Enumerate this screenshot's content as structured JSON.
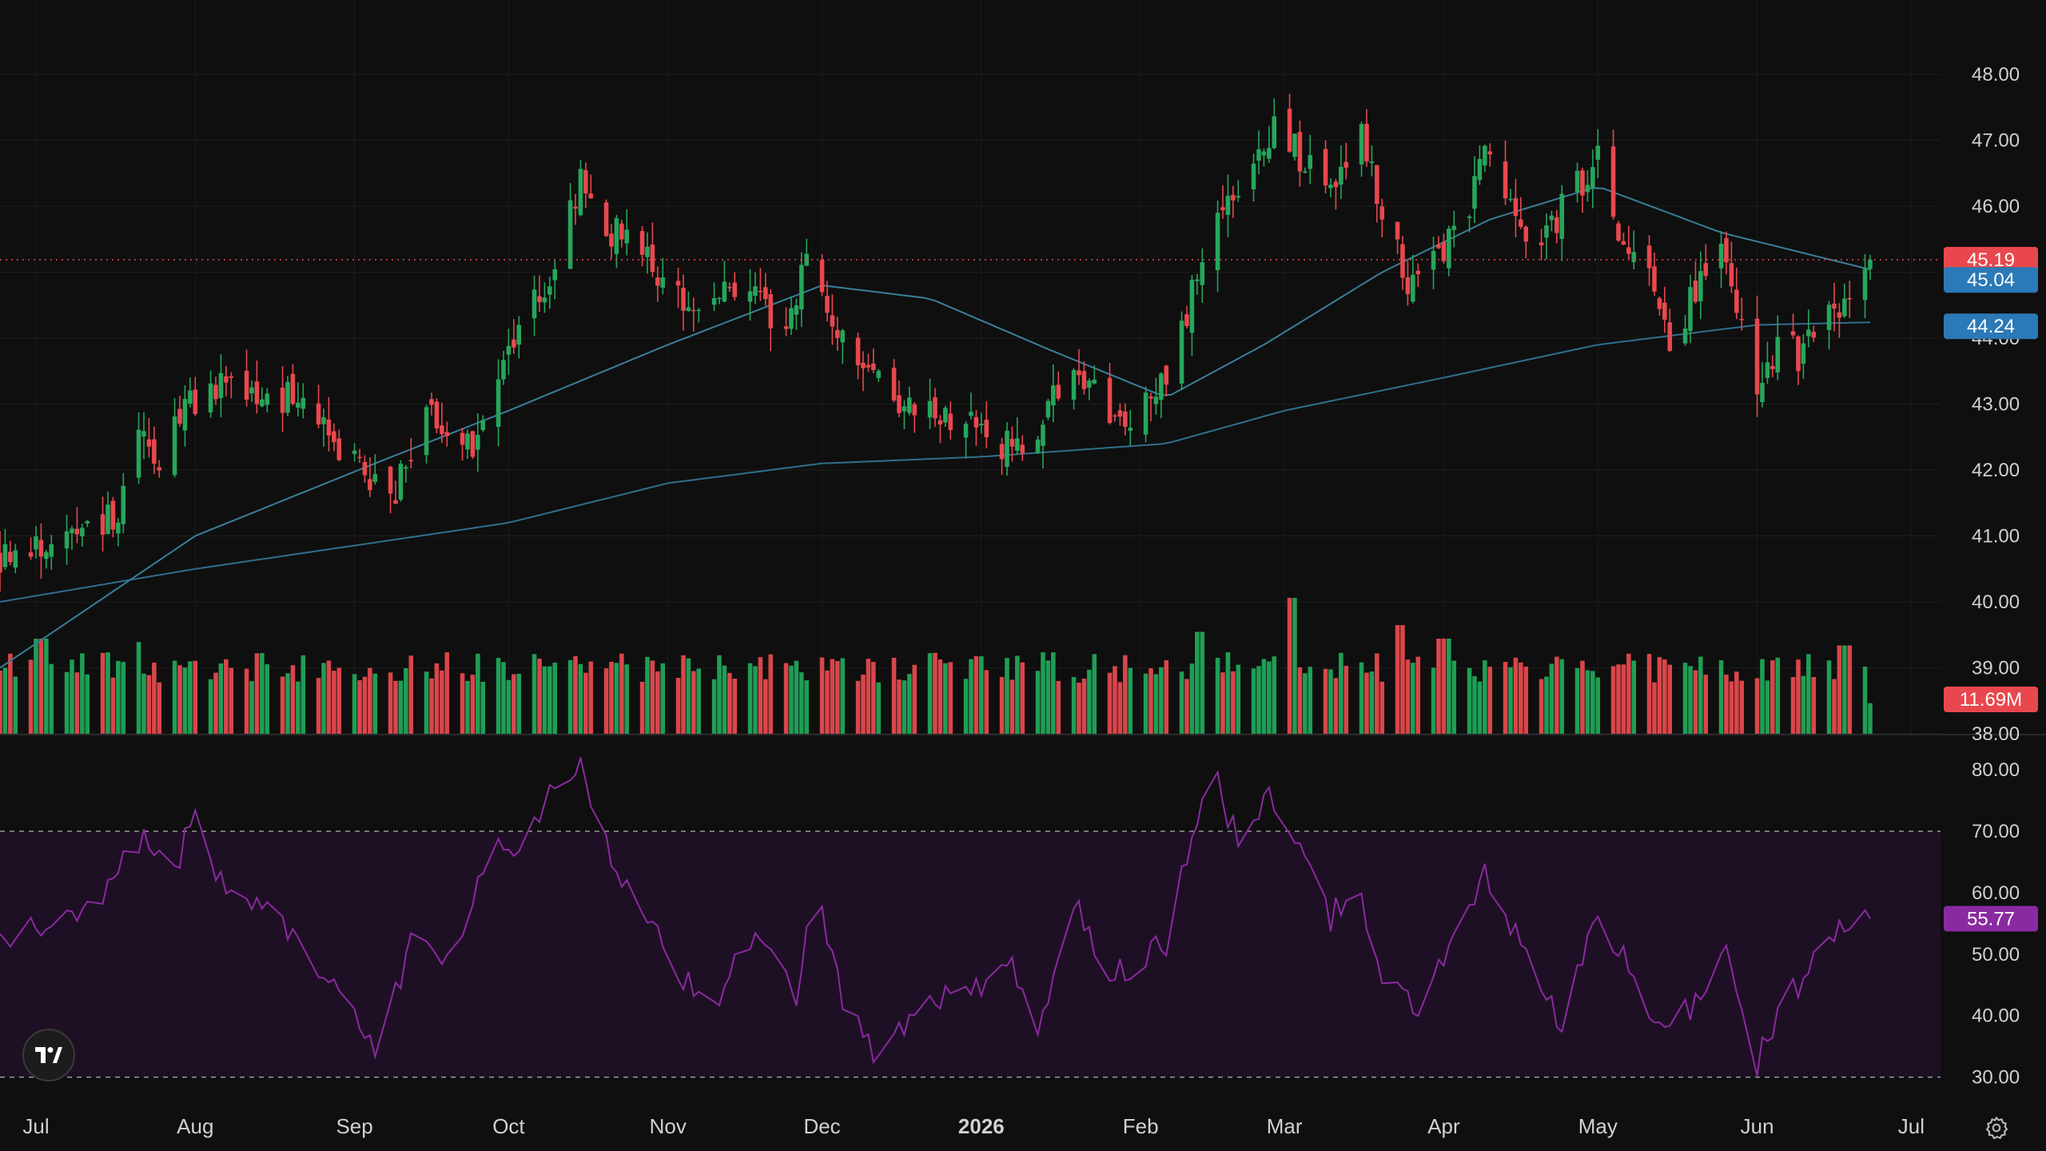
{
  "chart_data": {
    "type": "candlestick",
    "x_range": [
      "2025-06-24",
      "2026-06-23"
    ],
    "x_tick_labels": [
      {
        "label": "Jul",
        "date": "2025-07-01"
      },
      {
        "label": "Aug",
        "date": "2025-08-01"
      },
      {
        "label": "Sep",
        "date": "2025-09-01"
      },
      {
        "label": "Oct",
        "date": "2025-10-01"
      },
      {
        "label": "Nov",
        "date": "2025-11-01"
      },
      {
        "label": "Dec",
        "date": "2025-12-01"
      },
      {
        "label": "2026",
        "date": "2026-01-01"
      },
      {
        "label": "Feb",
        "date": "2026-02-01"
      },
      {
        "label": "Mar",
        "date": "2026-03-01"
      },
      {
        "label": "Apr",
        "date": "2026-04-01"
      },
      {
        "label": "May",
        "date": "2026-05-01"
      },
      {
        "label": "Jun",
        "date": "2026-06-01"
      },
      {
        "label": "Jul",
        "date": "2026-07-01"
      }
    ],
    "price_axis": {
      "ylim": [
        38.0,
        48.4
      ],
      "ticks": [
        "48.00",
        "47.00",
        "46.00",
        "45.00",
        "44.00",
        "43.00",
        "42.00",
        "41.00",
        "40.00",
        "39.00",
        "38.00"
      ]
    },
    "rsi_axis": {
      "ylim": [
        28,
        83
      ],
      "ticks": [
        "80.00",
        "70.00",
        "60.00",
        "50.00",
        "40.00",
        "30.00"
      ],
      "overbought": 70,
      "oversold": 30
    },
    "last_price": 45.19,
    "labels": {
      "price_badge": "45.19",
      "ma_short_badge": "45.04",
      "ma_long_badge": "44.24",
      "volume_badge": "11.69M",
      "rsi_badge": "55.77"
    },
    "close_anchors": [
      [
        "2025-06-24",
        40.7
      ],
      [
        "2025-07-03",
        40.9
      ],
      [
        "2025-07-10",
        41.3
      ],
      [
        "2025-07-17",
        41.2
      ],
      [
        "2025-07-21",
        42.5
      ],
      [
        "2025-07-25",
        42.2
      ],
      [
        "2025-07-31",
        43.0
      ],
      [
        "2025-08-05",
        43.3
      ],
      [
        "2025-08-12",
        43.0
      ],
      [
        "2025-08-19",
        43.1
      ],
      [
        "2025-08-26",
        42.6
      ],
      [
        "2025-09-02",
        42.0
      ],
      [
        "2025-09-08",
        41.5
      ],
      [
        "2025-09-15",
        42.8
      ],
      [
        "2025-09-23",
        42.3
      ],
      [
        "2025-09-30",
        43.5
      ],
      [
        "2025-10-06",
        44.5
      ],
      [
        "2025-10-10",
        45.2
      ],
      [
        "2025-10-15",
        46.3
      ],
      [
        "2025-10-20",
        45.5
      ],
      [
        "2025-10-24",
        45.7
      ],
      [
        "2025-10-29",
        45.0
      ],
      [
        "2025-11-05",
        44.4
      ],
      [
        "2025-11-12",
        44.9
      ],
      [
        "2025-11-19",
        44.6
      ],
      [
        "2025-11-24",
        44.1
      ],
      [
        "2025-11-28",
        45.1
      ],
      [
        "2025-12-03",
        44.4
      ],
      [
        "2025-12-10",
        43.4
      ],
      [
        "2025-12-17",
        42.9
      ],
      [
        "2025-12-24",
        42.8
      ],
      [
        "2026-01-02",
        42.6
      ],
      [
        "2026-01-09",
        42.2
      ],
      [
        "2026-01-13",
        42.9
      ],
      [
        "2026-01-20",
        43.5
      ],
      [
        "2026-01-27",
        42.8
      ],
      [
        "2026-02-02",
        43.0
      ],
      [
        "2026-02-06",
        43.3
      ],
      [
        "2026-02-12",
        45.0
      ],
      [
        "2026-02-17",
        46.2
      ],
      [
        "2026-02-20",
        46.0
      ],
      [
        "2026-02-27",
        47.2
      ],
      [
        "2026-03-04",
        46.8
      ],
      [
        "2026-03-11",
        46.2
      ],
      [
        "2026-03-16",
        47.1
      ],
      [
        "2026-03-20",
        46.0
      ],
      [
        "2026-03-25",
        44.8
      ],
      [
        "2026-03-31",
        45.3
      ],
      [
        "2026-04-06",
        46.1
      ],
      [
        "2026-04-09",
        46.8
      ],
      [
        "2026-04-13",
        46.0
      ],
      [
        "2026-04-20",
        45.4
      ],
      [
        "2026-04-27",
        46.3
      ],
      [
        "2026-05-01",
        46.7
      ],
      [
        "2026-05-05",
        45.4
      ],
      [
        "2026-05-11",
        44.9
      ],
      [
        "2026-05-15",
        44.0
      ],
      [
        "2026-05-20",
        44.7
      ],
      [
        "2026-05-26",
        45.3
      ],
      [
        "2026-06-01",
        43.3
      ],
      [
        "2026-06-05",
        43.9
      ],
      [
        "2026-06-10",
        43.7
      ],
      [
        "2026-06-15",
        44.7
      ],
      [
        "2026-06-19",
        44.4
      ],
      [
        "2026-06-23",
        45.19
      ]
    ],
    "volume_spikes": [
      {
        "date": "2025-07-02",
        "relative": 1.4
      },
      {
        "date": "2025-07-20",
        "relative": 1.35
      },
      {
        "date": "2026-02-13",
        "relative": 1.5
      },
      {
        "date": "2026-03-02",
        "relative": 2.0
      },
      {
        "date": "2026-03-23",
        "relative": 1.6
      },
      {
        "date": "2026-04-01",
        "relative": 1.4
      },
      {
        "date": "2026-06-18",
        "relative": 1.3
      }
    ],
    "ma_short": [
      [
        "2025-06-24",
        39.0
      ],
      [
        "2025-08-01",
        41.0
      ],
      [
        "2025-09-05",
        42.1
      ],
      [
        "2025-10-01",
        42.9
      ],
      [
        "2025-11-01",
        43.9
      ],
      [
        "2025-12-01",
        44.8
      ],
      [
        "2025-12-22",
        44.6
      ],
      [
        "2026-01-15",
        43.8
      ],
      [
        "2026-02-06",
        43.1
      ],
      [
        "2026-02-25",
        43.9
      ],
      [
        "2026-03-20",
        45.0
      ],
      [
        "2026-04-10",
        45.8
      ],
      [
        "2026-05-01",
        46.3
      ],
      [
        "2026-05-25",
        45.6
      ],
      [
        "2026-06-23",
        45.04
      ]
    ],
    "ma_long": [
      [
        "2025-06-24",
        40.0
      ],
      [
        "2025-08-01",
        40.5
      ],
      [
        "2025-09-05",
        40.9
      ],
      [
        "2025-10-01",
        41.2
      ],
      [
        "2025-11-01",
        41.8
      ],
      [
        "2025-12-01",
        42.1
      ],
      [
        "2026-01-01",
        42.2
      ],
      [
        "2026-02-06",
        42.4
      ],
      [
        "2026-03-01",
        42.9
      ],
      [
        "2026-04-01",
        43.4
      ],
      [
        "2026-05-01",
        43.9
      ],
      [
        "2026-06-01",
        44.2
      ],
      [
        "2026-06-23",
        44.24
      ]
    ],
    "rsi_anchors": [
      [
        "2025-06-24",
        53
      ],
      [
        "2025-07-10",
        55
      ],
      [
        "2025-07-22",
        70
      ],
      [
        "2025-07-28",
        64
      ],
      [
        "2025-08-01",
        73
      ],
      [
        "2025-08-06",
        62
      ],
      [
        "2025-08-19",
        54
      ],
      [
        "2025-08-28",
        45
      ],
      [
        "2025-09-05",
        34
      ],
      [
        "2025-09-12",
        52
      ],
      [
        "2025-09-19",
        48
      ],
      [
        "2025-09-26",
        65
      ],
      [
        "2025-10-06",
        70
      ],
      [
        "2025-10-10",
        78
      ],
      [
        "2025-10-15",
        80
      ],
      [
        "2025-10-20",
        68
      ],
      [
        "2025-10-28",
        55
      ],
      [
        "2025-11-04",
        46
      ],
      [
        "2025-11-10",
        43
      ],
      [
        "2025-11-18",
        52
      ],
      [
        "2025-11-26",
        44
      ],
      [
        "2025-11-30",
        60
      ],
      [
        "2025-12-05",
        42
      ],
      [
        "2025-12-12",
        33
      ],
      [
        "2025-12-22",
        42
      ],
      [
        "2026-01-02",
        44
      ],
      [
        "2026-01-07",
        49
      ],
      [
        "2026-01-12",
        36
      ],
      [
        "2026-01-20",
        58
      ],
      [
        "2026-01-26",
        46
      ],
      [
        "2026-02-02",
        50
      ],
      [
        "2026-02-06",
        52
      ],
      [
        "2026-02-11",
        70
      ],
      [
        "2026-02-16",
        78
      ],
      [
        "2026-02-20",
        68
      ],
      [
        "2026-02-26",
        75
      ],
      [
        "2026-03-04",
        66
      ],
      [
        "2026-03-10",
        56
      ],
      [
        "2026-03-15",
        62
      ],
      [
        "2026-03-20",
        44
      ],
      [
        "2026-03-27",
        42
      ],
      [
        "2026-04-03",
        52
      ],
      [
        "2026-04-09",
        63
      ],
      [
        "2026-04-16",
        51
      ],
      [
        "2026-04-24",
        38
      ],
      [
        "2026-05-01",
        56
      ],
      [
        "2026-05-08",
        47
      ],
      [
        "2026-05-14",
        36
      ],
      [
        "2026-05-21",
        44
      ],
      [
        "2026-05-26",
        51
      ],
      [
        "2026-06-01",
        32
      ],
      [
        "2026-06-06",
        43
      ],
      [
        "2026-06-12",
        48
      ],
      [
        "2026-06-18",
        54
      ],
      [
        "2026-06-23",
        55.77
      ]
    ]
  },
  "colors": {
    "background": "#0f0f0f",
    "up": "#26a65b",
    "down": "#e8484d",
    "volume_up": "#1f9e55",
    "volume_down": "#d9464a",
    "ma_short": "#3a7f9a",
    "ma_long": "#2f6f8c",
    "rsi_line": "#8a2aa0",
    "rsi_band": "#1e1024",
    "price_badge": "#e8484d",
    "ma_short_badge": "#2b79b6",
    "ma_long_badge": "#2b79b6",
    "volume_badge": "#e8484d",
    "rsi_badge": "#8a2aa0"
  },
  "icons": {
    "logo": "tradingview-logo-icon",
    "settings": "gear-icon"
  }
}
